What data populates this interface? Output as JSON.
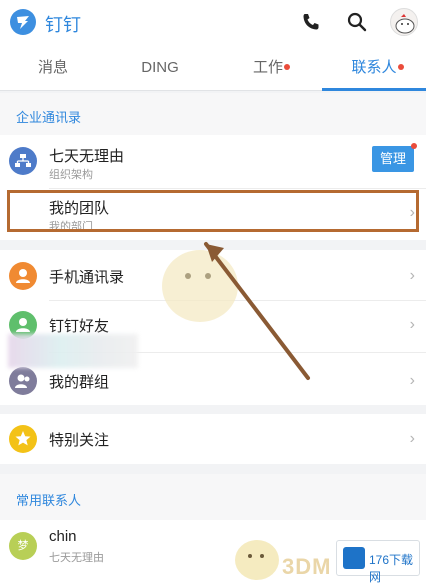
{
  "header": {
    "app_name": "钉钉",
    "icons": [
      "phone-icon",
      "search-icon",
      "profile-avatar"
    ]
  },
  "tabs": [
    {
      "label": "消息",
      "active": false,
      "dot": false
    },
    {
      "label": "DING",
      "active": false,
      "dot": false
    },
    {
      "label": "工作",
      "active": false,
      "dot": true
    },
    {
      "label": "联系人",
      "active": true,
      "dot": true
    }
  ],
  "enterprise": {
    "section_title": "企业通讯录",
    "org": {
      "name": "七天无理由",
      "sub": "组织架构",
      "icon": "org-structure-icon"
    },
    "manage_label": "管理",
    "my_team": {
      "title": "我的团队",
      "sub": "我的部门"
    }
  },
  "contacts": [
    {
      "label": "手机通讯录",
      "icon": "phone-contacts-icon",
      "color": "#f08a32"
    },
    {
      "label": "钉钉好友",
      "icon": "dingtalk-friends-icon",
      "color": "#5fbf6c"
    },
    {
      "label": "我的群组",
      "icon": "my-groups-icon",
      "color": "#7f7c9b"
    }
  ],
  "special": {
    "label": "特别关注",
    "icon": "star-icon",
    "color": "#f3c217"
  },
  "frequent": {
    "section_title": "常用联系人",
    "items": [
      {
        "name": "chin",
        "sub": "七天无理由",
        "avatar_text": "梦",
        "color": "#b8cf56"
      }
    ]
  },
  "watermark": {
    "brand": "3DM",
    "site": "176下载网"
  },
  "colors": {
    "accent": "#2f87dd",
    "badge_red": "#ea4c3b",
    "highlight": "#b56a31"
  }
}
